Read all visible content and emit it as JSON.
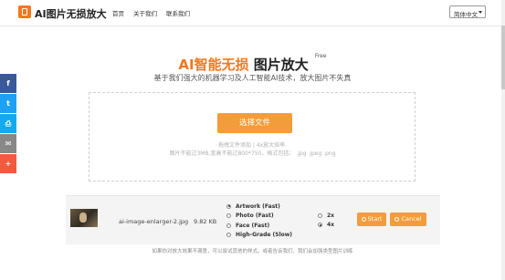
{
  "header": {
    "logo_text": "AI图片无损放大",
    "nav": [
      {
        "label": "首页"
      },
      {
        "label": "关于我们"
      },
      {
        "label": "联系我们"
      }
    ],
    "language": "简体中文"
  },
  "hero": {
    "title_orange": "AI智能无损",
    "title_dark": "图片放大",
    "badge": "Free",
    "subtitle": "基于我们强大的机器学习及人工智能AI技术，放大图片不失真"
  },
  "upload": {
    "button_label": "选择文件",
    "hint_line1": "拖拽文件添加 | 4x放大倍率.",
    "hint_line2": "图片不能过3MB,宽高不能过800*750，格式包括： .jpg .jpeg .png"
  },
  "share": [
    {
      "icon": "facebook-icon",
      "color": "#3b5998",
      "glyph": "f"
    },
    {
      "icon": "twitter-icon",
      "color": "#1da1f2",
      "glyph": "t"
    },
    {
      "icon": "print-icon",
      "color": "#12aaeb",
      "glyph": "⎙"
    },
    {
      "icon": "email-icon",
      "color": "#888888",
      "glyph": "✉"
    },
    {
      "icon": "more-icon",
      "color": "#f05a3e",
      "glyph": "+"
    }
  ],
  "file": {
    "name": "ai-image-enlarger-2.jpg",
    "size": "9.82 KB",
    "types": [
      {
        "label": "Artwork (Fast)",
        "checked": true
      },
      {
        "label": "Photo (Fast)",
        "checked": false
      },
      {
        "label": "Face (Fast)",
        "checked": false
      },
      {
        "label": "High-Grade (Slow)",
        "checked": false
      }
    ],
    "scales": [
      {
        "label": "2x",
        "checked": false
      },
      {
        "label": "4x",
        "checked": true
      }
    ],
    "start_label": "Start",
    "cancel_label": "Cancel"
  },
  "footnote": "如果你对放大效果不满意，可以尝试其他的样式。或者告诉我们，我们会加强类型图片训练",
  "colors": {
    "accent": "#f3771e",
    "button": "#f39c3b"
  }
}
